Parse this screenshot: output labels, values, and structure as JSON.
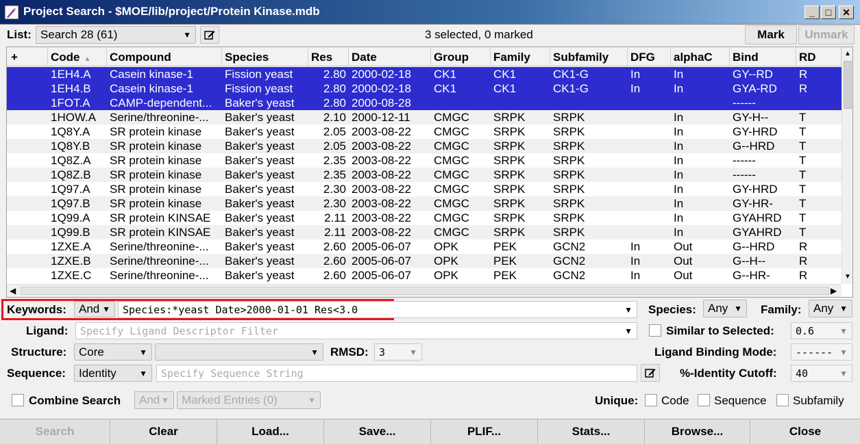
{
  "window": {
    "title": "Project Search - $MOE/lib/project/Protein Kinase.mdb",
    "icon": "moe-app-icon"
  },
  "toolbar": {
    "list_label": "List:",
    "list_value": "Search 28 (61)",
    "status": "3 selected, 0 marked",
    "mark_label": "Mark",
    "unmark_label": "Unmark"
  },
  "table": {
    "columns": [
      "+",
      "Code",
      "Compound",
      "Species",
      "Res",
      "Date",
      "Group",
      "Family",
      "Subfamily",
      "DFG",
      "alphaC",
      "Bind",
      "RD"
    ],
    "rows": [
      {
        "selected": true,
        "cells": [
          "",
          "1EH4.A",
          "Casein kinase-1",
          "Fission yeast",
          "2.80",
          "2000-02-18",
          "CK1",
          "CK1",
          "CK1-G",
          "In",
          "In",
          "GY--RD",
          "R"
        ]
      },
      {
        "selected": true,
        "cells": [
          "",
          "1EH4.B",
          "Casein kinase-1",
          "Fission yeast",
          "2.80",
          "2000-02-18",
          "CK1",
          "CK1",
          "CK1-G",
          "In",
          "In",
          "GYA-RD",
          "R"
        ]
      },
      {
        "selected": true,
        "cells": [
          "",
          "1FOT.A",
          "CAMP-dependent...",
          "Baker's yeast",
          "2.80",
          "2000-08-28",
          "",
          "",
          "",
          "",
          "",
          "------",
          ""
        ]
      },
      {
        "selected": false,
        "cells": [
          "",
          "1HOW.A",
          "Serine/threonine-...",
          "Baker's yeast",
          "2.10",
          "2000-12-11",
          "CMGC",
          "SRPK",
          "SRPK",
          "",
          "In",
          "GY-H--",
          "T"
        ]
      },
      {
        "selected": false,
        "cells": [
          "",
          "1Q8Y.A",
          "SR protein kinase",
          "Baker's yeast",
          "2.05",
          "2003-08-22",
          "CMGC",
          "SRPK",
          "SRPK",
          "",
          "In",
          "GY-HRD",
          "T"
        ]
      },
      {
        "selected": false,
        "cells": [
          "",
          "1Q8Y.B",
          "SR protein kinase",
          "Baker's yeast",
          "2.05",
          "2003-08-22",
          "CMGC",
          "SRPK",
          "SRPK",
          "",
          "In",
          "G--HRD",
          "T"
        ]
      },
      {
        "selected": false,
        "cells": [
          "",
          "1Q8Z.A",
          "SR protein kinase",
          "Baker's yeast",
          "2.35",
          "2003-08-22",
          "CMGC",
          "SRPK",
          "SRPK",
          "",
          "In",
          "------",
          "T"
        ]
      },
      {
        "selected": false,
        "cells": [
          "",
          "1Q8Z.B",
          "SR protein kinase",
          "Baker's yeast",
          "2.35",
          "2003-08-22",
          "CMGC",
          "SRPK",
          "SRPK",
          "",
          "In",
          "------",
          "T"
        ]
      },
      {
        "selected": false,
        "cells": [
          "",
          "1Q97.A",
          "SR protein kinase",
          "Baker's yeast",
          "2.30",
          "2003-08-22",
          "CMGC",
          "SRPK",
          "SRPK",
          "",
          "In",
          "GY-HRD",
          "T"
        ]
      },
      {
        "selected": false,
        "cells": [
          "",
          "1Q97.B",
          "SR protein kinase",
          "Baker's yeast",
          "2.30",
          "2003-08-22",
          "CMGC",
          "SRPK",
          "SRPK",
          "",
          "In",
          "GY-HR-",
          "T"
        ]
      },
      {
        "selected": false,
        "cells": [
          "",
          "1Q99.A",
          "SR protein KINSAE",
          "Baker's yeast",
          "2.11",
          "2003-08-22",
          "CMGC",
          "SRPK",
          "SRPK",
          "",
          "In",
          "GYAHRD",
          "T"
        ]
      },
      {
        "selected": false,
        "cells": [
          "",
          "1Q99.B",
          "SR protein KINSAE",
          "Baker's yeast",
          "2.11",
          "2003-08-22",
          "CMGC",
          "SRPK",
          "SRPK",
          "",
          "In",
          "GYAHRD",
          "T"
        ]
      },
      {
        "selected": false,
        "cells": [
          "",
          "1ZXE.A",
          "Serine/threonine-...",
          "Baker's yeast",
          "2.60",
          "2005-06-07",
          "OPK",
          "PEK",
          "GCN2",
          "In",
          "Out",
          "G--HRD",
          "R"
        ]
      },
      {
        "selected": false,
        "cells": [
          "",
          "1ZXE.B",
          "Serine/threonine-...",
          "Baker's yeast",
          "2.60",
          "2005-06-07",
          "OPK",
          "PEK",
          "GCN2",
          "In",
          "Out",
          "G--H--",
          "R"
        ]
      },
      {
        "selected": false,
        "cells": [
          "",
          "1ZXE.C",
          "Serine/threonine-...",
          "Baker's yeast",
          "2.60",
          "2005-06-07",
          "OPK",
          "PEK",
          "GCN2",
          "In",
          "Out",
          "G--HR-",
          "R"
        ]
      }
    ]
  },
  "filters": {
    "keywords_label": "Keywords:",
    "keywords_op": "And",
    "keywords_value": "Species:*yeast Date>2000-01-01 Res<3.0",
    "species_label": "Species:",
    "species_value": "Any",
    "family_label": "Family:",
    "family_value": "Any",
    "ligand_label": "Ligand:",
    "ligand_placeholder": "Specify Ligand Descriptor Filter",
    "similar_label": "Similar to Selected:",
    "similar_value": "0.6",
    "structure_label": "Structure:",
    "structure_value": "Core",
    "structure_second": "",
    "rmsd_label": "RMSD:",
    "rmsd_value": "3",
    "binding_mode_label": "Ligand Binding Mode:",
    "binding_mode_value": "------",
    "sequence_label": "Sequence:",
    "sequence_value": "Identity",
    "sequence_placeholder": "Specify Sequence String",
    "identity_label": "%-Identity Cutoff:",
    "identity_value": "40",
    "combine_label": "Combine Search",
    "combine_op": "And",
    "combine_target": "Marked Entries (0)",
    "unique_label": "Unique:",
    "unique_code": "Code",
    "unique_sequence": "Sequence",
    "unique_subfamily": "Subfamily"
  },
  "buttons": {
    "search": "Search",
    "clear": "Clear",
    "load": "Load...",
    "save": "Save...",
    "plif": "PLIF...",
    "stats": "Stats...",
    "browse": "Browse...",
    "close": "Close"
  },
  "colors": {
    "selection": "#2c2ccf",
    "highlight_box": "#e8151b"
  }
}
